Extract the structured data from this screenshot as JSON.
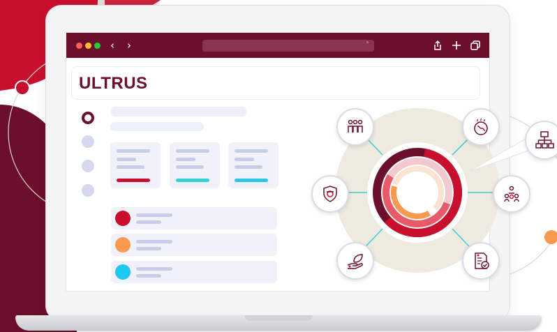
{
  "brand": {
    "logo_text": "ULTRUS",
    "primary_color": "#6b0f2a",
    "accent_red": "#c8102e",
    "accent_orange": "#f59a4e",
    "accent_cyan": "#2bc6e6"
  },
  "browser": {
    "back_icon": "chevron-left-icon",
    "forward_icon": "chevron-right-icon",
    "back_glyph": "‹",
    "forward_glyph": "›",
    "share_icon": "share-icon",
    "new_tab_icon": "plus-icon",
    "tabs_icon": "tabs-icon"
  },
  "dashboard": {
    "stat_cards": [
      {
        "accent_color": "#c8102e"
      },
      {
        "accent_color": "#35d0d6"
      },
      {
        "accent_color": "#2bc6e6"
      }
    ],
    "list_items": [
      {
        "dot_color": "#c8102e"
      },
      {
        "dot_color": "#f59a4e"
      },
      {
        "dot_color": "#1ec8f0"
      }
    ]
  },
  "hub": {
    "nodes": [
      {
        "icon": "team-icon"
      },
      {
        "icon": "global-health-icon"
      },
      {
        "icon": "safety-shield-icon"
      },
      {
        "icon": "org-people-icon"
      },
      {
        "icon": "sustainability-hand-leaf-icon"
      },
      {
        "icon": "compliance-document-icon"
      },
      {
        "icon": "org-chart-icon"
      }
    ]
  }
}
